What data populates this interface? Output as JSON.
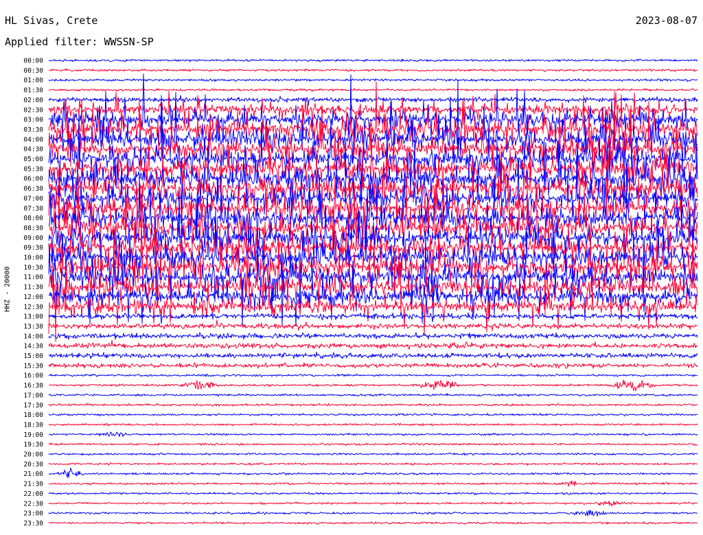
{
  "header": {
    "station": "HL Sivas, Crete",
    "filter": "Applied filter: WWSSN-SP",
    "date": "2023-08-07",
    "channel": "HHZ - 20000"
  },
  "colors": {
    "trace_a": "#0000ff",
    "trace_b": "#ff0033",
    "text": "#000000",
    "background": "#ffffff"
  },
  "chart_data": {
    "type": "helicorder",
    "title": "HL Sivas, Crete",
    "subtitle": "Applied filter: WWSSN-SP",
    "date": "2023-08-07",
    "ylabel": "HHZ - 20000",
    "xlabel": "",
    "grid": false,
    "legend": "none",
    "row_interval_minutes": 30,
    "row_labels": [
      "00:00",
      "00:30",
      "01:00",
      "01:30",
      "02:00",
      "02:30",
      "03:00",
      "03:30",
      "04:00",
      "04:30",
      "05:00",
      "05:30",
      "06:00",
      "06:30",
      "07:00",
      "07:30",
      "08:00",
      "08:30",
      "09:00",
      "09:30",
      "10:00",
      "10:30",
      "11:00",
      "11:30",
      "12:00",
      "12:30",
      "13:00",
      "13:30",
      "14:00",
      "14:30",
      "15:00",
      "15:30",
      "16:00",
      "16:30",
      "17:00",
      "17:30",
      "18:00",
      "18:30",
      "19:00",
      "19:30",
      "20:00",
      "20:30",
      "21:00",
      "21:30",
      "22:00",
      "22:30",
      "23:00",
      "23:30"
    ],
    "row_colors": [
      "#0000ff",
      "#ff0033"
    ],
    "activity_level": [
      0.1,
      0.12,
      0.15,
      0.15,
      0.25,
      0.55,
      0.9,
      1.0,
      1.0,
      1.0,
      1.0,
      1.0,
      1.0,
      1.0,
      1.0,
      1.0,
      1.0,
      1.0,
      1.0,
      1.0,
      1.0,
      1.0,
      1.0,
      0.9,
      0.85,
      0.75,
      0.35,
      0.3,
      0.3,
      0.3,
      0.25,
      0.2,
      0.15,
      0.12,
      0.1,
      0.1,
      0.09,
      0.08,
      0.08,
      0.07,
      0.07,
      0.07,
      0.06,
      0.06,
      0.06,
      0.06,
      0.06,
      0.06
    ],
    "events": [
      {
        "time": "16:30",
        "minute": 7,
        "amplitude": 0.9
      },
      {
        "time": "16:30",
        "minute": 18,
        "amplitude": 0.8
      },
      {
        "time": "16:30",
        "minute": 27,
        "amplitude": 1.0
      },
      {
        "time": "19:00",
        "minute": 3,
        "amplitude": 0.4
      },
      {
        "time": "21:00",
        "minute": 1,
        "amplitude": 0.5
      },
      {
        "time": "21:30",
        "minute": 24,
        "amplitude": 0.4
      },
      {
        "time": "22:30",
        "minute": 26,
        "amplitude": 0.4
      },
      {
        "time": "23:00",
        "minute": 25,
        "amplitude": 0.45
      }
    ]
  }
}
